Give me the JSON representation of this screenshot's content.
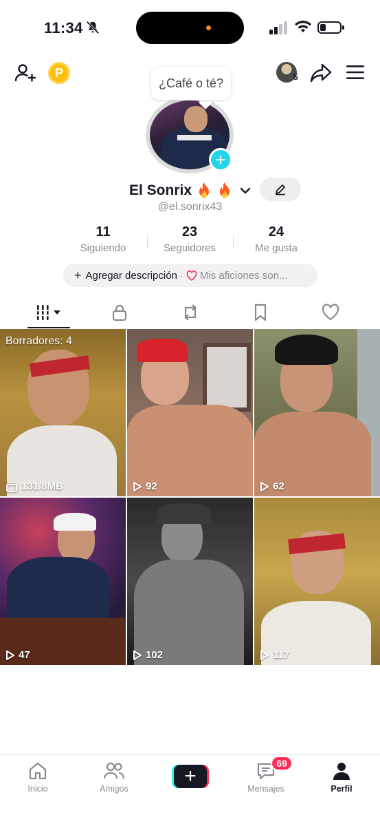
{
  "status_bar": {
    "time": "11:34"
  },
  "top_bar": {
    "friend_count": "5",
    "coin_letter": "P"
  },
  "bubble": {
    "text": "¿Café o té?"
  },
  "profile": {
    "display_name": "El Sonrix",
    "username": "@el.sonrix43",
    "stats": [
      {
        "value": "11",
        "label": "Siguiendo"
      },
      {
        "value": "23",
        "label": "Seguidores"
      },
      {
        "value": "24",
        "label": "Me gusta"
      }
    ],
    "bio": {
      "add_label": "Agregar descripción",
      "separator": "·",
      "hobbies_label": "Mis aficiones son..."
    }
  },
  "grid": {
    "drafts_label": "Borradores: 4",
    "items": [
      {
        "meta": "131.8MB",
        "type": "drafts"
      },
      {
        "meta": "92",
        "type": "video"
      },
      {
        "meta": "62",
        "type": "video"
      },
      {
        "meta": "47",
        "type": "video"
      },
      {
        "meta": "102",
        "type": "video"
      },
      {
        "meta": "117",
        "type": "video"
      }
    ]
  },
  "bottom_nav": {
    "items": [
      {
        "label": "Inicio"
      },
      {
        "label": "Amigos"
      },
      {
        "label": "Mensajes"
      },
      {
        "label": "Perfil"
      }
    ],
    "messages_badge": "69"
  },
  "colors": {
    "accent_cyan": "#20d5ec",
    "accent_red": "#fe2c55",
    "text": "#161823",
    "muted": "#8a8b91"
  }
}
